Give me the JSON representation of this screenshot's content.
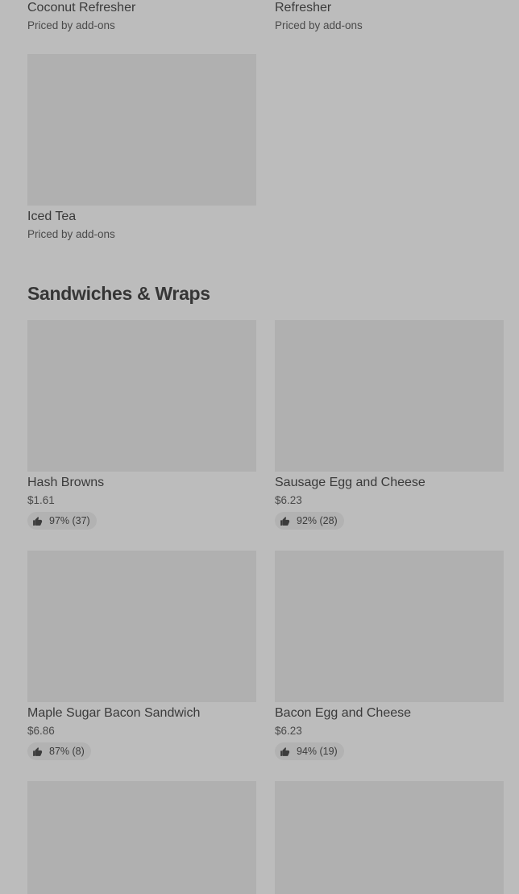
{
  "top_items": [
    {
      "name": "Coconut Refresher",
      "price": "Priced by add-ons"
    },
    {
      "name": "Refresher",
      "price": "Priced by add-ons"
    }
  ],
  "iced_tea": {
    "name": "Iced Tea",
    "price": "Priced by add-ons"
  },
  "section": {
    "title": "Sandwiches & Wraps"
  },
  "sandwiches": [
    {
      "name": "Hash Browns",
      "price": "$1.61",
      "rating": "97% (37)"
    },
    {
      "name": "Sausage Egg and Cheese",
      "price": "$6.23",
      "rating": "92% (28)"
    },
    {
      "name": "Maple Sugar Bacon Sandwich",
      "price": "$6.86",
      "rating": "87% (8)"
    },
    {
      "name": "Bacon Egg and Cheese",
      "price": "$6.23",
      "rating": "94% (19)"
    }
  ]
}
